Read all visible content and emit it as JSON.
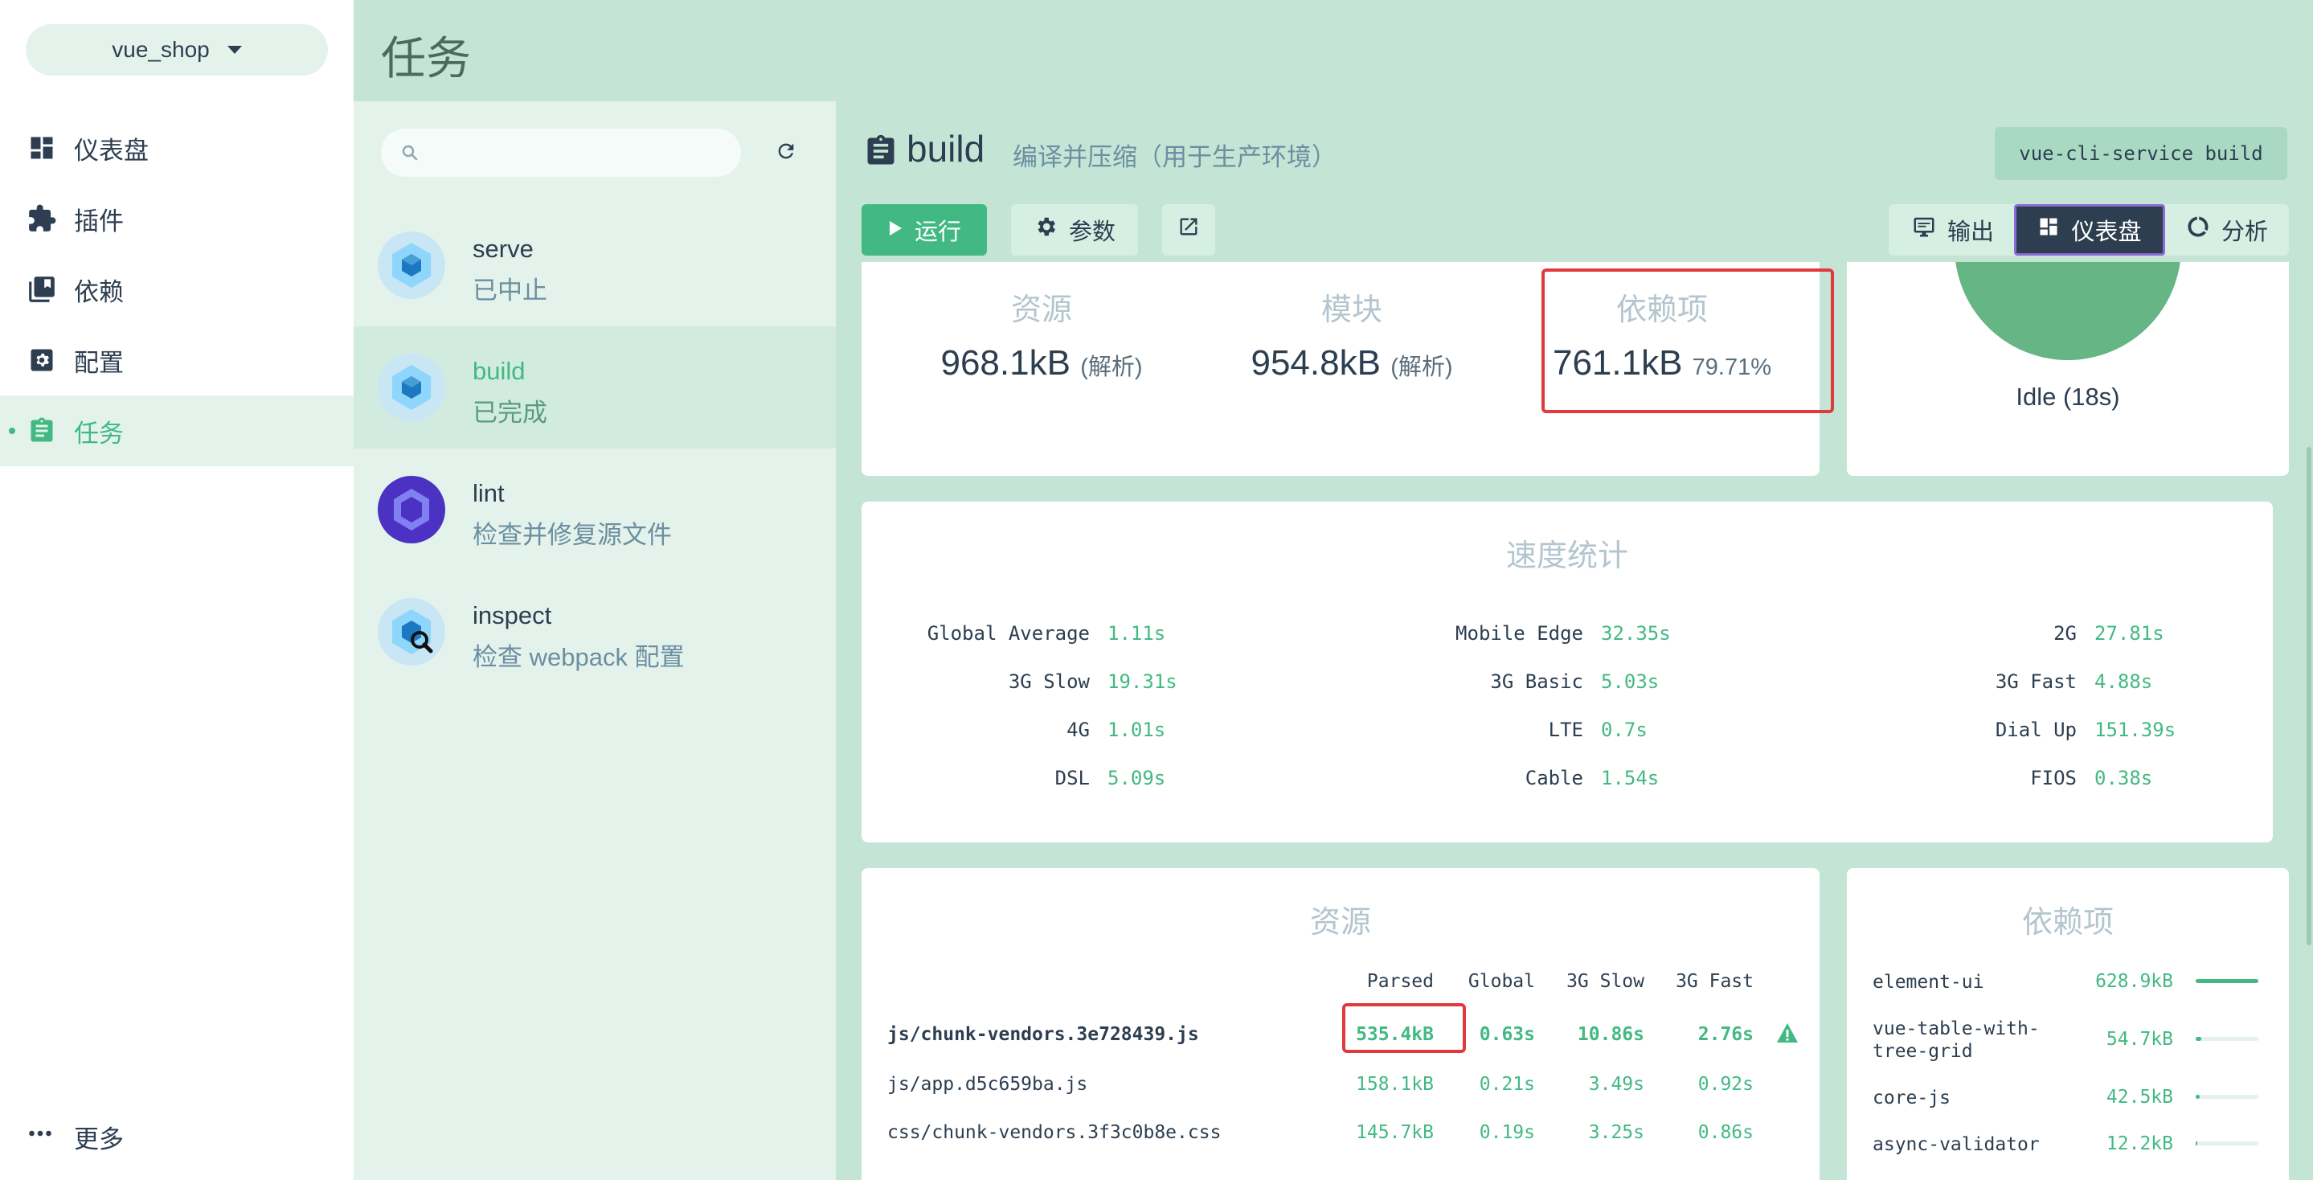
{
  "sidebar": {
    "project": "vue_shop",
    "items": [
      {
        "label": "仪表盘",
        "icon": "dashboard-icon"
      },
      {
        "label": "插件",
        "icon": "puzzle-icon"
      },
      {
        "label": "依赖",
        "icon": "library-icon"
      },
      {
        "label": "配置",
        "icon": "settings-icon"
      },
      {
        "label": "任务",
        "icon": "clipboard-icon",
        "active": true
      }
    ],
    "more": "更多"
  },
  "header": {
    "title": "任务"
  },
  "tasks": [
    {
      "name": "serve",
      "status": "已中止"
    },
    {
      "name": "build",
      "status": "已完成",
      "active": true
    },
    {
      "name": "lint",
      "status": "检查并修复源文件"
    },
    {
      "name": "inspect",
      "status": "检查 webpack 配置"
    }
  ],
  "task": {
    "title": "build",
    "description": "编译并压缩（用于生产环境）",
    "command": "vue-cli-service build"
  },
  "toolbar": {
    "run": "运行",
    "params": "参数",
    "tabs": {
      "output": "输出",
      "dashboard": "仪表盘",
      "analyze": "分析"
    }
  },
  "stats": {
    "assets": {
      "label": "资源",
      "value": "968.1kB",
      "suffix": "(解析)"
    },
    "modules": {
      "label": "模块",
      "value": "954.8kB",
      "suffix": "(解析)"
    },
    "deps": {
      "label": "依赖项",
      "value": "761.1kB",
      "suffix": "79.71%"
    }
  },
  "status": "Idle (18s)",
  "speed": {
    "title": "速度统计",
    "rows": [
      [
        {
          "label": "Global Average",
          "value": "1.11s"
        },
        {
          "label": "Mobile Edge",
          "value": "32.35s"
        },
        {
          "label": "2G",
          "value": "27.81s"
        }
      ],
      [
        {
          "label": "3G Slow",
          "value": "19.31s"
        },
        {
          "label": "3G Basic",
          "value": "5.03s"
        },
        {
          "label": "3G Fast",
          "value": "4.88s"
        }
      ],
      [
        {
          "label": "4G",
          "value": "1.01s"
        },
        {
          "label": "LTE",
          "value": "0.7s"
        },
        {
          "label": "Dial Up",
          "value": "151.39s"
        }
      ],
      [
        {
          "label": "DSL",
          "value": "5.09s"
        },
        {
          "label": "Cable",
          "value": "1.54s"
        },
        {
          "label": "FIOS",
          "value": "0.38s"
        }
      ]
    ]
  },
  "assets": {
    "title": "资源",
    "columns": [
      "Parsed",
      "Global",
      "3G Slow",
      "3G Fast"
    ],
    "rows": [
      {
        "name": "js/chunk-vendors.3e728439.js",
        "parsed": "535.4kB",
        "global": "0.63s",
        "slow": "10.86s",
        "fast": "2.76s"
      },
      {
        "name": "js/app.d5c659ba.js",
        "parsed": "158.1kB",
        "global": "0.21s",
        "slow": "3.49s",
        "fast": "0.92s"
      },
      {
        "name": "css/chunk-vendors.3f3c0b8e.css",
        "parsed": "145.7kB",
        "global": "0.19s",
        "slow": "3.25s",
        "fast": "0.86s"
      }
    ]
  },
  "dependencies": {
    "title": "依赖项",
    "rows": [
      {
        "name": "element-ui",
        "size": "628.9kB",
        "fraction": 1.0
      },
      {
        "name": "vue-table-with-tree-grid",
        "size": "54.7kB",
        "fraction": 0.087
      },
      {
        "name": "core-js",
        "size": "42.5kB",
        "fraction": 0.068
      },
      {
        "name": "async-validator",
        "size": "12.2kB",
        "fraction": 0.019
      }
    ]
  },
  "colors": {
    "accent": "#42b983",
    "dark": "#2c3e50",
    "highlight": "#e0393e"
  }
}
